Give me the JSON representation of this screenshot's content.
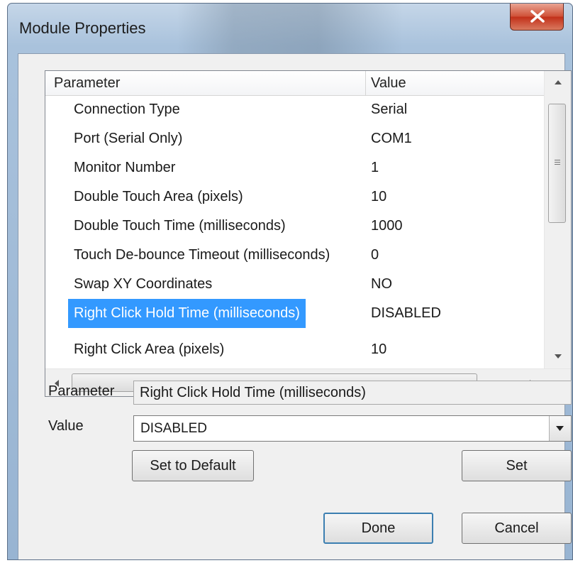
{
  "window": {
    "title": "Module Properties"
  },
  "list": {
    "columns": {
      "parameter": "Parameter",
      "value": "Value"
    },
    "rows": [
      {
        "parameter": "Connection Type",
        "value": "Serial"
      },
      {
        "parameter": "Port (Serial Only)",
        "value": "COM1"
      },
      {
        "parameter": "Monitor Number",
        "value": "1"
      },
      {
        "parameter": "Double Touch Area (pixels)",
        "value": "10"
      },
      {
        "parameter": "Double Touch Time (milliseconds)",
        "value": "1000"
      },
      {
        "parameter": "Touch De-bounce Timeout (milliseconds)",
        "value": "0"
      },
      {
        "parameter": "Swap XY Coordinates",
        "value": "NO"
      },
      {
        "parameter": "Right Click Hold Time (milliseconds)",
        "value": "DISABLED"
      },
      {
        "parameter": "Right Click Area (pixels)",
        "value": "10"
      }
    ],
    "selected_index": 7,
    "hscroll_grip": "III"
  },
  "form": {
    "parameter_label": "Parameter",
    "parameter_value": "Right Click Hold Time (milliseconds)",
    "value_label": "Value",
    "value_selected": "DISABLED"
  },
  "buttons": {
    "set_default": "Set to Default",
    "set": "Set",
    "done": "Done",
    "cancel": "Cancel"
  },
  "colors": {
    "selection": "#3399ff",
    "close_button": "#c2311a"
  }
}
